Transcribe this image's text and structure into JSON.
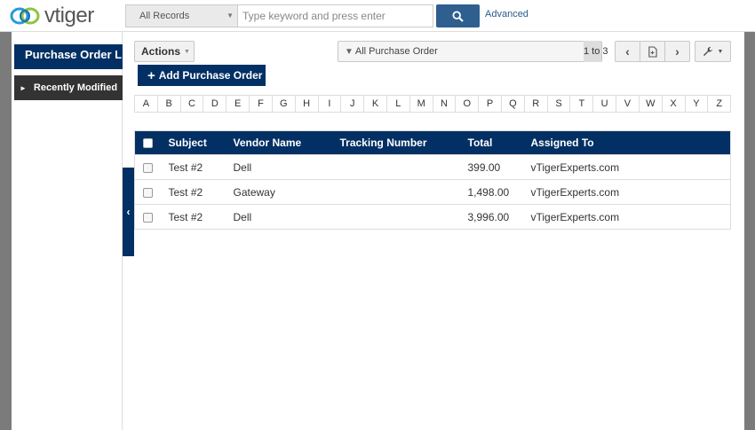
{
  "header": {
    "logo_text": "vtiger",
    "scope": "All Records",
    "search_placeholder": "Type keyword and press enter",
    "advanced_label": "Advanced"
  },
  "sidebar": {
    "module_title": "Purchase Order List",
    "recent_label": "Recently Modified"
  },
  "toolbar": {
    "actions_label": "Actions",
    "add_label": "Add Purchase Order",
    "filter_label": "All Purchase Order",
    "page_info": "1 to 3"
  },
  "alphabet": [
    "A",
    "B",
    "C",
    "D",
    "E",
    "F",
    "G",
    "H",
    "I",
    "J",
    "K",
    "L",
    "M",
    "N",
    "O",
    "P",
    "Q",
    "R",
    "S",
    "T",
    "U",
    "V",
    "W",
    "X",
    "Y",
    "Z"
  ],
  "table": {
    "columns": [
      "Subject",
      "Vendor Name",
      "Tracking Number",
      "Total",
      "Assigned To"
    ],
    "rows": [
      {
        "subject": "Test #2",
        "vendor": "Dell",
        "tracking": "",
        "total": "399.00",
        "assigned": "vTigerExperts.com"
      },
      {
        "subject": "Test #2",
        "vendor": "Gateway",
        "tracking": "",
        "total": "1,498.00",
        "assigned": "vTigerExperts.com"
      },
      {
        "subject": "Test #2",
        "vendor": "Dell",
        "tracking": "",
        "total": "3,996.00",
        "assigned": "vTigerExperts.com"
      }
    ]
  },
  "colors": {
    "primary": "#033064",
    "search_button": "#2f5f8f",
    "link": "#2b5a88",
    "frame_gray": "#7b7b7b"
  },
  "icons": [
    "vtiger-logo-icon",
    "search-icon",
    "funnel-icon",
    "prev-icon",
    "export-icon",
    "next-icon",
    "wrench-icon",
    "collapse-icon",
    "plus-icon"
  ]
}
